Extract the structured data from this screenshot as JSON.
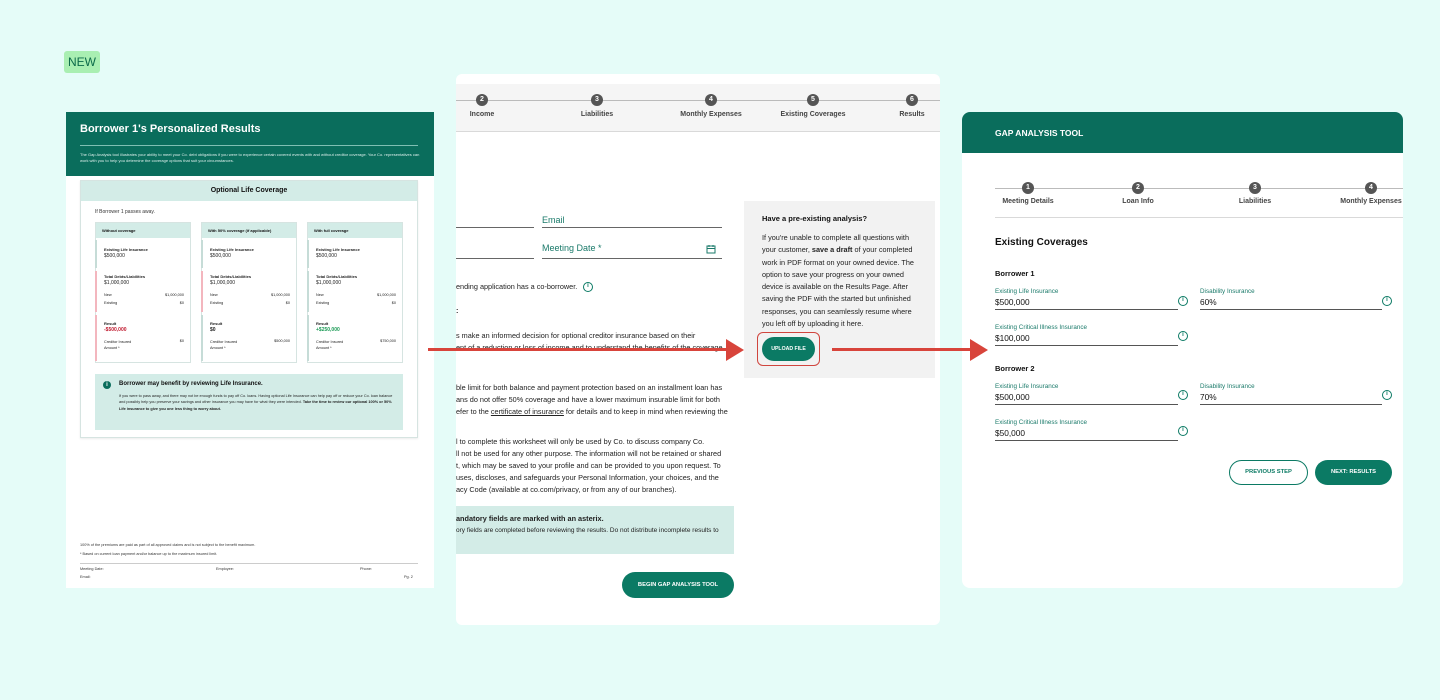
{
  "badge": "NEW",
  "panel1": {
    "title": "Borrower 1's Personalized Results",
    "description": "The Gap Analysis tool illustrates your ability to meet your Co. debt obligations if you were to experience certain covered events with and without creditor coverage. Your Co. representatives can work with you to help you determine the coverage options that suit your circumstances.",
    "card_title": "Optional Life Coverage",
    "intro": "If Borrower 1 passes away.",
    "columns": [
      {
        "header": "Without coverage",
        "existing_label": "Existing Life Insurance",
        "existing_value": "$500,000",
        "debts_label": "Total Debts/Liabilities",
        "debts_value": "$1,000,000",
        "new_label": "New",
        "new_value": "$1,000,000",
        "existing_row_label": "Existing",
        "existing_row_value": "$0",
        "result_label": "Result",
        "result_value": "-$500,000",
        "cia_label": "Creditor Insured Amount *",
        "cia_value": "$0"
      },
      {
        "header": "With 50% coverage (if applicable)",
        "existing_label": "Existing Life Insurance",
        "existing_value": "$500,000",
        "debts_label": "Total Debts/Liabilities",
        "debts_value": "$1,000,000",
        "new_label": "New",
        "new_value": "$1,000,000",
        "existing_row_label": "Existing",
        "existing_row_value": "$0",
        "result_label": "Result",
        "result_value": "$0",
        "cia_label": "Creditor Insured Amount *",
        "cia_value": "$500,000"
      },
      {
        "header": "With full coverage",
        "existing_label": "Existing Life Insurance",
        "existing_value": "$500,000",
        "debts_label": "Total Debts/Liabilities",
        "debts_value": "$1,000,000",
        "new_label": "New",
        "new_value": "$1,000,000",
        "existing_row_label": "Existing",
        "existing_row_value": "$0",
        "result_label": "Result",
        "result_value": "+$250,000",
        "cia_label": "Creditor Insured Amount *",
        "cia_value": "$750,000"
      }
    ],
    "note_title": "Borrower may benefit by reviewing Life Insurance.",
    "note_body": "If you were to pass away, and there may not be enough funds to pay off Co. loans. Having optional Life Insurance can help pay off or reduce your Co. loan balance and possibly help you preserve your savings and other insurance you may have for what they were intended.",
    "note_bold": "Take the time to review our optional 100% or 50% Life insurance to give you one less thing to worry about.",
    "footnote1": "100% of the premiums are paid as part of all approved claims and is not subject to the benefit maximum.",
    "footnote2": "* Based on current loan payment and/or balance up to the maximum insured limit.",
    "meeting_date_label": "Meeting Date:",
    "employee_label": "Employee:",
    "phone_label": "Phone:",
    "email_label": "Email:",
    "page": "Pg. 2"
  },
  "panel2": {
    "steps": [
      {
        "num": "2",
        "label": "Income"
      },
      {
        "num": "3",
        "label": "Liabilities"
      },
      {
        "num": "4",
        "label": "Monthly Expenses"
      },
      {
        "num": "5",
        "label": "Existing Coverages"
      },
      {
        "num": "6",
        "label": "Results"
      }
    ],
    "email_label": "Email",
    "meeting_date_label": "Meeting Date *",
    "coborrower_text": "ending application has a co-borrower.",
    "colon": ":",
    "para1_line1": "s make an informed decision for optional creditor insurance based on their",
    "para1_line2": "ent of a reduction or loss of income and to understand the benefits of the coverage",
    "para2_line1": "ble limit for both balance and payment protection based on an installment loan has",
    "para2_line2": "ans do not offer 50% coverage and have a lower maximum insurable limit for both",
    "para2_line3_pre": "efer to the ",
    "para2_link": "certificate of insurance",
    "para2_line3_post": " for details and to keep in mind when reviewing the",
    "para3_line1": "l to complete this worksheet will only be used by Co. to discuss company Co.",
    "para3_line2": "ll not be used for any other purpose. The information will not be retained or shared",
    "para3_line3": "t, which may be saved to your profile and can be provided to you upon request.  To",
    "para3_line4": " uses, discloses, and safeguards your Personal Information, your choices, and the",
    "para3_line5": "acy Code (available at co.com/privacy, or from any of our branches).",
    "mand_title": "andatory fields are marked with an asterix.",
    "mand_body": "ory fields are completed before reviewing the results. Do not distribute incomplete results to",
    "pre_title": "Have a pre-existing analysis?",
    "pre_text_1": "If you're unable to complete all questions with your customer, ",
    "pre_text_bold": "save a draft",
    "pre_text_2": " of your completed work in PDF format on your owned device. The option to save your progress on your owned device is available on the Results Page. After saving the PDF with the started but unfinished responses, you can seamlessly resume where you left off by uploading it here.",
    "upload_label": "UPLOAD FILE",
    "begin_label": "BEGIN GAP ANALYSIS TOOL"
  },
  "panel3": {
    "title": "GAP ANALYSIS TOOL",
    "steps": [
      {
        "num": "1",
        "label": "Meeting Details"
      },
      {
        "num": "2",
        "label": "Loan Info"
      },
      {
        "num": "3",
        "label": "Liabilities"
      },
      {
        "num": "4",
        "label": "Monthly Expenses"
      }
    ],
    "section_title": "Existing Coverages",
    "borrower1": {
      "title": "Borrower 1",
      "life_label": "Existing Life Insurance",
      "life_value": "$500,000",
      "disability_label": "Disability Insurance",
      "disability_value": "60%",
      "critical_label": "Existing Critical Illness Insurance",
      "critical_value": "$100,000"
    },
    "borrower2": {
      "title": "Borrower 2",
      "life_label": "Existing Life Insurance",
      "life_value": "$500,000",
      "disability_label": "Disability Insurance",
      "disability_value": "70%",
      "critical_label": "Existing Critical Illness Insurance",
      "critical_value": "$50,000"
    },
    "prev_label": "PREVIOUS STEP",
    "next_label": "NEXT: RESULTS"
  },
  "colors": {
    "brand": "#0a6d5c",
    "accent": "#0b7a64",
    "arrow": "#d8443b",
    "background": "#e5fcf8"
  },
  "icons": [
    "info-icon",
    "calendar-icon",
    "arrow-right-icon"
  ]
}
